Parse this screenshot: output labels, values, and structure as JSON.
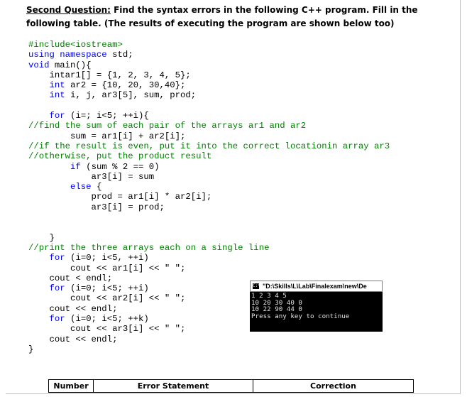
{
  "question": {
    "label": "Second Question:",
    "text": " Find the syntax errors in the following C++ program. Fill in the following table. (The results of executing the program are shown below too)"
  },
  "code_lines": [
    [
      [
        "pp",
        "#include<iostream>"
      ]
    ],
    [
      [
        "kw",
        "using namespace"
      ],
      [
        "",
        "std;"
      ]
    ],
    [
      [
        "kw",
        "void"
      ],
      [
        "",
        "main(){"
      ]
    ],
    [
      [
        "",
        "    intar1[] = {1, 2, 3, 4, 5};"
      ]
    ],
    [
      [
        "",
        "    "
      ],
      [
        "kw",
        "int"
      ],
      [
        "",
        "ar2 = {10, 20, 30,40};"
      ]
    ],
    [
      [
        "",
        "    "
      ],
      [
        "kw",
        "int"
      ],
      [
        "",
        "i, j, ar3[5], sum, prod;"
      ]
    ],
    [
      [
        "",
        ""
      ]
    ],
    [
      [
        "",
        "    "
      ],
      [
        "kw",
        "for"
      ],
      [
        "",
        "(i=; i<5; ++i){"
      ]
    ],
    [
      [
        "cm",
        "//find the sum of each pair of the arrays ar1 and ar2"
      ]
    ],
    [
      [
        "",
        "        sum = ar1[i] + ar2[i];"
      ]
    ],
    [
      [
        "cm",
        "//if the result is even, put it into the correct locationin array ar3"
      ]
    ],
    [
      [
        "cm",
        "//otherwise, put the product result"
      ]
    ],
    [
      [
        "",
        "        "
      ],
      [
        "kw",
        "if"
      ],
      [
        "",
        "(sum % 2 == 0)"
      ]
    ],
    [
      [
        "",
        "            ar3[i] = sum"
      ]
    ],
    [
      [
        "",
        "        "
      ],
      [
        "kw",
        "else"
      ],
      [
        "",
        "{"
      ]
    ],
    [
      [
        "",
        "            prod = ar1[i] * ar2[i];"
      ]
    ],
    [
      [
        "",
        "            ar3[i] = prod;"
      ]
    ],
    [
      [
        "",
        ""
      ]
    ],
    [
      [
        "",
        ""
      ]
    ],
    [
      [
        "",
        "    }"
      ]
    ],
    [
      [
        "cm",
        "//print the three arrays each on a single line"
      ]
    ],
    [
      [
        "",
        "    "
      ],
      [
        "kw",
        "for"
      ],
      [
        "",
        "(i=0; i<5, ++i)"
      ]
    ],
    [
      [
        "",
        "        cout << ar1[i] << \" \";"
      ]
    ],
    [
      [
        "",
        "    cout < endl;"
      ]
    ],
    [
      [
        "",
        "    "
      ],
      [
        "kw",
        "for"
      ],
      [
        "",
        "(i=0; i<5; ++i)"
      ]
    ],
    [
      [
        "",
        "        cout << ar2[i] << \" \";"
      ]
    ],
    [
      [
        "",
        "    cout << endl;"
      ]
    ],
    [
      [
        "",
        "    "
      ],
      [
        "kw",
        "for"
      ],
      [
        "",
        "(i=0; i<5; ++k)"
      ]
    ],
    [
      [
        "",
        "        cout << ar3[i] << \" \";"
      ]
    ],
    [
      [
        "",
        "    cout << endl;"
      ]
    ],
    [
      [
        "",
        "}"
      ]
    ]
  ],
  "console": {
    "icon_glyph": "C:\\",
    "title": "\"D:\\Skills\\L\\Lab\\Finalexam\\new\\De",
    "output_lines": [
      "1 2 3 4 5",
      "10 20 30 40 0",
      "10 22 90 44 0",
      "Press any key to continue"
    ]
  },
  "table": {
    "headers": [
      "Number",
      "Error Statement",
      "Correction"
    ]
  },
  "colors": {
    "keyword": "#0000ff",
    "comment": "#008000",
    "text": "#000000",
    "console_bg": "#000000"
  }
}
